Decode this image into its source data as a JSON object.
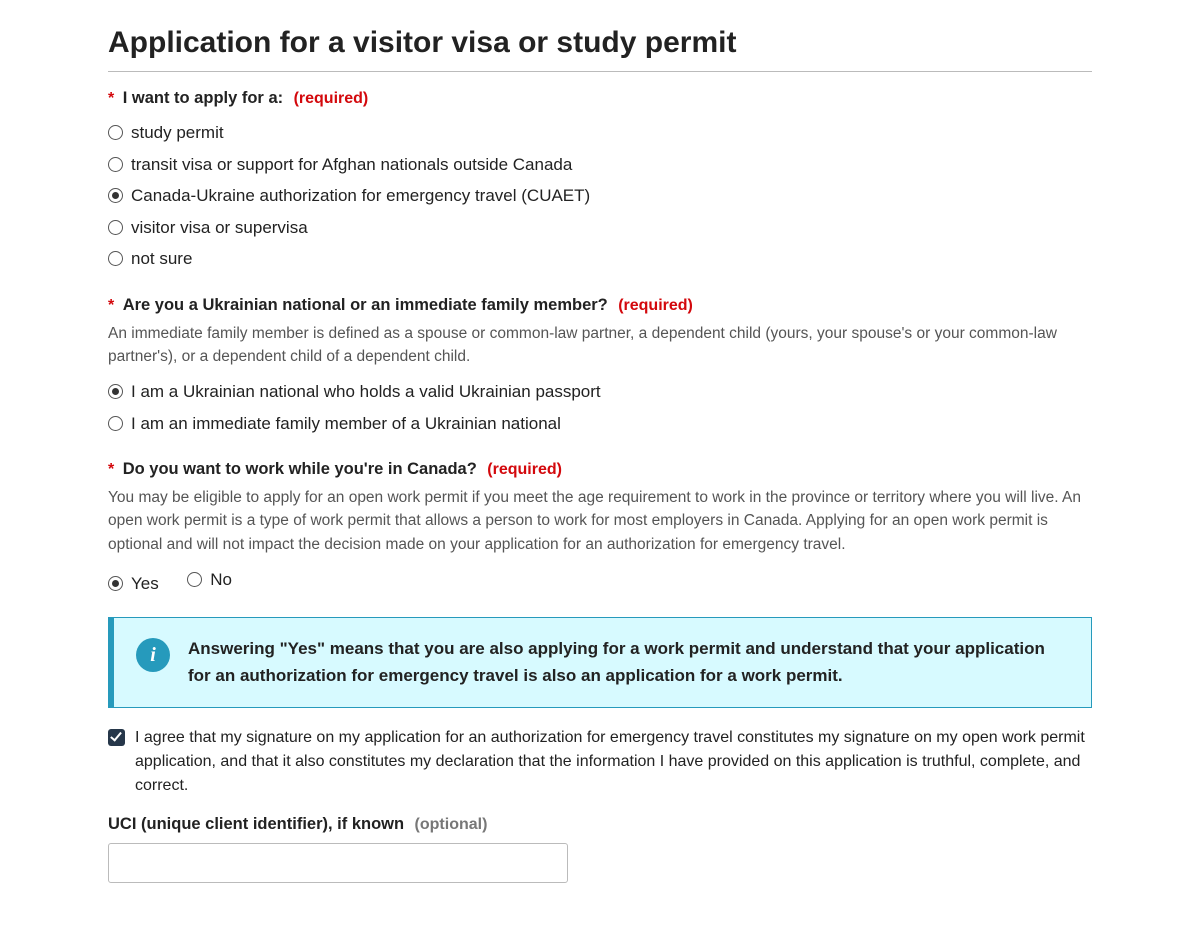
{
  "title": "Application for a visitor visa or study permit",
  "required_tag": "(required)",
  "optional_tag": "(optional)",
  "q_apply": {
    "label": "I want to apply for a:",
    "options": [
      "study permit",
      "transit visa or support for Afghan nationals outside Canada",
      "Canada-Ukraine authorization for emergency travel (CUAET)",
      "visitor visa or supervisa",
      "not sure"
    ],
    "selected_index": 2
  },
  "q_ukrainian": {
    "label": "Are you a Ukrainian national or an immediate family member?",
    "help": "An immediate family member is defined as a spouse or common-law partner, a dependent child (yours, your spouse's or your common-law partner's), or a dependent child of a dependent child.",
    "options": [
      "I am a Ukrainian national who holds a valid Ukrainian passport",
      "I am an immediate family member of a Ukrainian national"
    ],
    "selected_index": 0
  },
  "q_work": {
    "label": "Do you want to work while you're in Canada?",
    "help": "You may be eligible to apply for an open work permit if you meet the age requirement to work in the province or territory where you will live. An open work permit is a type of work permit that allows a person to work for most employers in Canada. Applying for an open work permit is optional and will not impact the decision made on your application for an authorization for emergency travel.",
    "options": [
      "Yes",
      "No"
    ],
    "selected_index": 0
  },
  "info_box": {
    "text": "Answering \"Yes\" means that you are also applying for a work permit and understand that your application for an authorization for emergency travel is also an application for a work permit."
  },
  "agree_checkbox": {
    "label": "I agree that my signature on my application for an authorization for emergency travel constitutes my signature on my open work permit application, and that it also constitutes my declaration that the information I have provided on this application is truthful, complete, and correct.",
    "checked": true
  },
  "uci": {
    "label": "UCI (unique client identifier), if known",
    "value": ""
  }
}
